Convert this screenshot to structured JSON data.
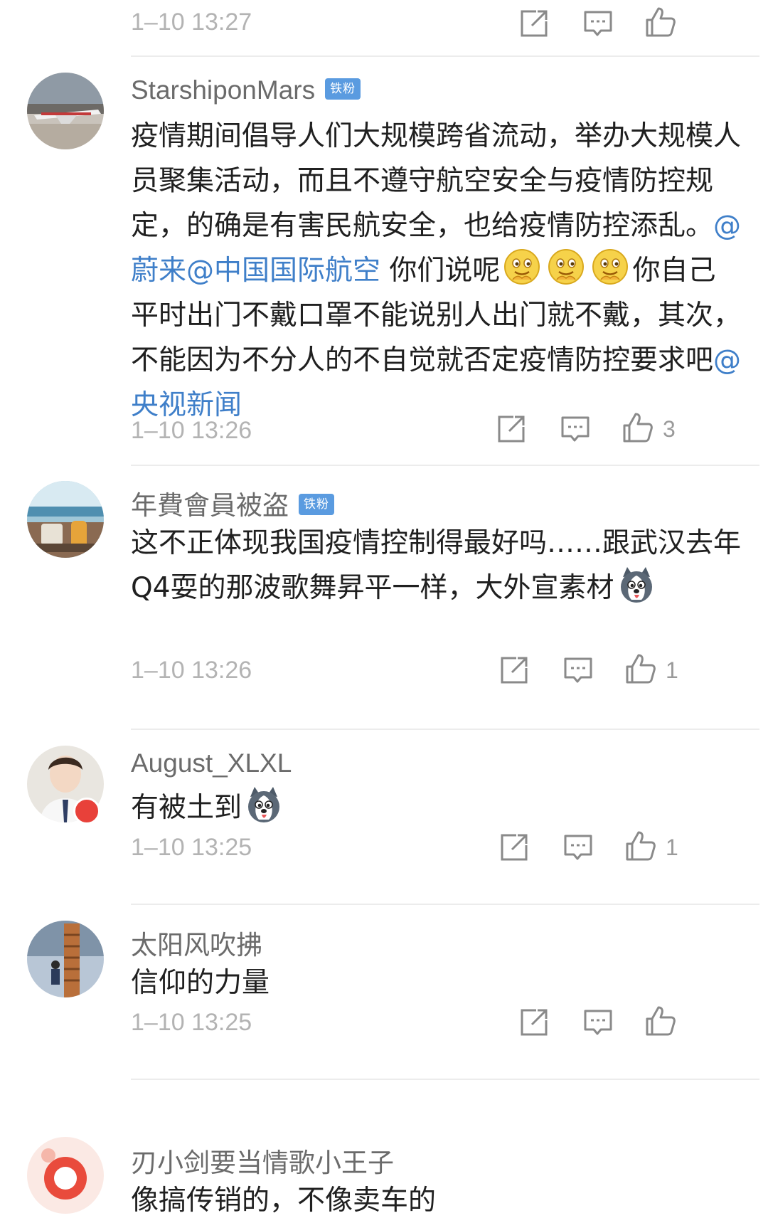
{
  "top": {
    "timestamp": "1–10 13:27"
  },
  "comments": [
    {
      "username": "StarshiponMars",
      "badge": "铁粉",
      "text_a": "疫情期间倡导人们大规模跨省流动，举办大规模人员聚集活动，而且不遵守航空安全与疫情防控规定，的确是有害民航安全，也给疫情防控添乱。",
      "mention_1": "@蔚来",
      "mention_2": "@中国国际航空",
      "text_b": " 你们说呢",
      "text_c": "你自己平时出门不戴口罩不能说别人出门就不戴，其次，不能因为不分人的不自觉就否定疫情防控要求吧",
      "mention_3": "@央视新闻",
      "timestamp": "1–10 13:26",
      "likes": "3"
    },
    {
      "username": "年費會員被盗",
      "badge": "铁粉",
      "text_a": "这不正体现我国疫情控制得最好吗……跟武汉去年Q4耍的那波歌舞昇平一样，大外宣素材",
      "timestamp": "1–10 13:26",
      "likes": "1"
    },
    {
      "username": "August_XLXL",
      "text_a": "有被土到",
      "timestamp": "1–10 13:25",
      "likes": "1"
    },
    {
      "username": "太阳风吹拂",
      "text_a": "信仰的力量",
      "timestamp": "1–10 13:25",
      "likes": ""
    },
    {
      "username": "刃小剑要当情歌小王子",
      "text_a": "像搞传销的，不像卖车的"
    }
  ],
  "colors": {
    "mention": "#3f7fc9",
    "badge": "#5a9be0",
    "timestamp": "#b3b3b3"
  },
  "icons": [
    "share-icon",
    "comment-icon",
    "like-icon",
    "grin-emoji-icon",
    "husky-emoji-icon"
  ]
}
